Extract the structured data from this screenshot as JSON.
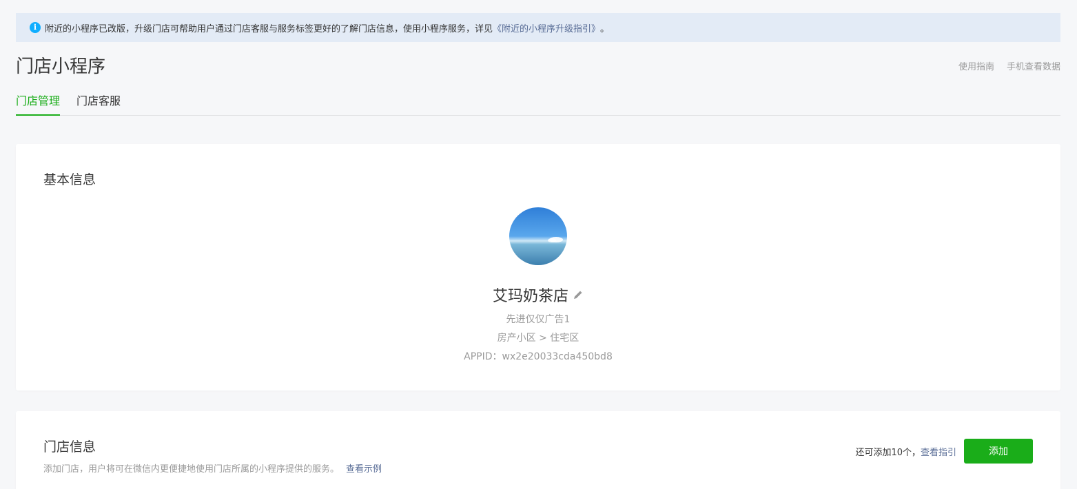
{
  "notice": {
    "text": "附近的小程序已改版，升级门店可帮助用户通过门店客服与服务标签更好的了解门店信息，使用小程序服务，详见",
    "link": "《附近的小程序升级指引》",
    "end": "。",
    "icon": "info-icon",
    "icon_color": "#10aeff"
  },
  "header": {
    "title": "门店小程序",
    "links": [
      "使用指南",
      "手机查看数据"
    ]
  },
  "tabs": [
    {
      "label": "门店管理",
      "active": true
    },
    {
      "label": "门店客服",
      "active": false
    }
  ],
  "basic_info": {
    "title": "基本信息",
    "store_name": "艾玛奶茶店",
    "subtitle": "先进仅仅广告1",
    "category": "房产小区 > 住宅区",
    "appid": "APPID：wx2e20033cda450bd8"
  },
  "store_info": {
    "title": "门店信息",
    "desc": "添加门店，用户将可在微信内更便捷地使用门店所属的小程序提供的服务。",
    "example_link": "查看示例",
    "remaining": "还可添加10个，",
    "guide_link": "查看指引",
    "add_label": "添加"
  },
  "colors": {
    "accent": "#1aad19",
    "link": "#576b95",
    "notice_bg": "#e3ebf6"
  }
}
